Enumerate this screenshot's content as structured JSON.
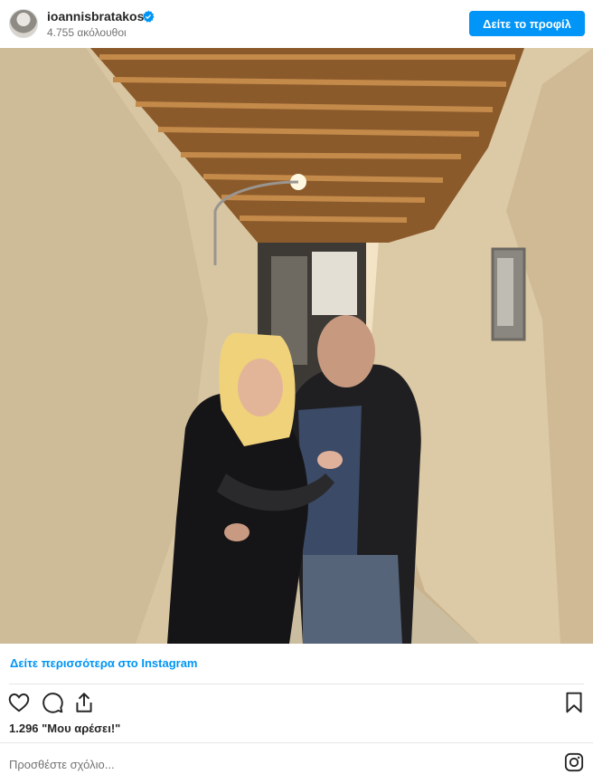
{
  "header": {
    "username": "ioannisbratakos",
    "verified_icon": "verified-badge-icon",
    "followers": "4.755 ακόλουθοι",
    "view_profile_label": "Δείτε το προφίλ"
  },
  "post": {
    "image_alt": "Δύο άτομα σε στενό δρομάκι",
    "more_link": "Δείτε περισσότερα στο Instagram",
    "likes": "1.296 \"Μου αρέσει!\"",
    "comment_placeholder": "Προσθέστε σχόλιο..."
  },
  "icons": {
    "like": "heart-icon",
    "comment": "comment-icon",
    "share": "share-icon",
    "save": "bookmark-icon",
    "instagram": "instagram-icon"
  },
  "colors": {
    "accent": "#0095f6",
    "text": "#262626",
    "muted": "#737373"
  }
}
